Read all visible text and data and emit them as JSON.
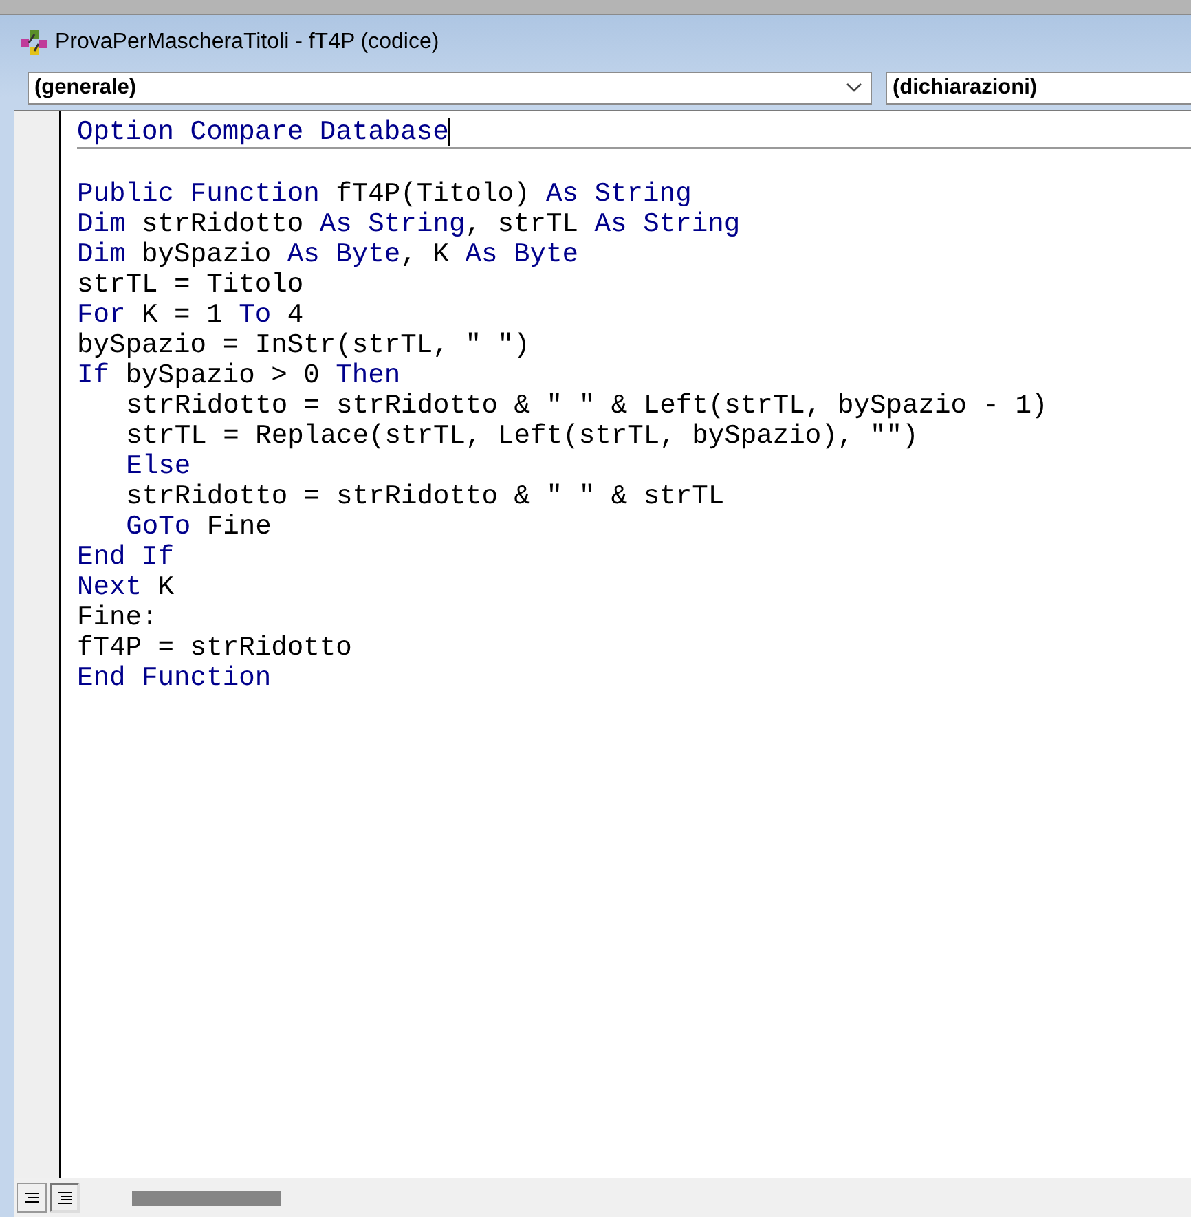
{
  "window": {
    "title": "ProvaPerMascheraTitoli - fT4P (codice)"
  },
  "object_dropdown": {
    "value": "(generale)"
  },
  "procedure_dropdown": {
    "value": "(dichiarazioni)"
  },
  "sections": [
    {
      "lines": [
        {
          "indented": false,
          "tokens": [
            {
              "kind": "keyword",
              "text": "Option Compare Database"
            }
          ]
        }
      ]
    },
    {
      "lines": [
        {
          "indented": false,
          "tokens": [
            {
              "kind": "keyword",
              "text": "Public Function"
            },
            {
              "kind": "plain",
              "text": " fT4P(Titolo) "
            },
            {
              "kind": "keyword",
              "text": "As String"
            }
          ]
        },
        {
          "indented": false,
          "tokens": [
            {
              "kind": "keyword",
              "text": "Dim"
            },
            {
              "kind": "plain",
              "text": " strRidotto "
            },
            {
              "kind": "keyword",
              "text": "As String"
            },
            {
              "kind": "plain",
              "text": ", strTL "
            },
            {
              "kind": "keyword",
              "text": "As String"
            }
          ]
        },
        {
          "indented": false,
          "tokens": [
            {
              "kind": "keyword",
              "text": "Dim"
            },
            {
              "kind": "plain",
              "text": " bySpazio "
            },
            {
              "kind": "keyword",
              "text": "As Byte"
            },
            {
              "kind": "plain",
              "text": ", K "
            },
            {
              "kind": "keyword",
              "text": "As Byte"
            }
          ]
        },
        {
          "indented": false,
          "tokens": [
            {
              "kind": "plain",
              "text": "strTL = Titolo"
            }
          ]
        },
        {
          "indented": false,
          "tokens": [
            {
              "kind": "keyword",
              "text": "For"
            },
            {
              "kind": "plain",
              "text": " K = 1 "
            },
            {
              "kind": "keyword",
              "text": "To"
            },
            {
              "kind": "plain",
              "text": " 4"
            }
          ]
        },
        {
          "indented": false,
          "tokens": [
            {
              "kind": "plain",
              "text": "bySpazio = InStr(strTL, \" \")"
            }
          ]
        },
        {
          "indented": false,
          "tokens": [
            {
              "kind": "keyword",
              "text": "If"
            },
            {
              "kind": "plain",
              "text": " bySpazio > 0 "
            },
            {
              "kind": "keyword",
              "text": "Then"
            }
          ]
        },
        {
          "indented": true,
          "tokens": [
            {
              "kind": "plain",
              "text": "strRidotto = strRidotto & \" \" & Left(strTL, bySpazio - 1)"
            }
          ]
        },
        {
          "indented": true,
          "tokens": [
            {
              "kind": "plain",
              "text": "strTL = Replace(strTL, Left(strTL, bySpazio), \"\")"
            }
          ]
        },
        {
          "indented": true,
          "tokens": [
            {
              "kind": "keyword",
              "text": "Else"
            }
          ]
        },
        {
          "indented": true,
          "tokens": [
            {
              "kind": "plain",
              "text": "strRidotto = strRidotto & \" \" & strTL"
            }
          ]
        },
        {
          "indented": true,
          "tokens": [
            {
              "kind": "keyword",
              "text": "GoTo"
            },
            {
              "kind": "plain",
              "text": " Fine"
            }
          ]
        },
        {
          "indented": false,
          "tokens": [
            {
              "kind": "keyword",
              "text": "End If"
            }
          ]
        },
        {
          "indented": false,
          "tokens": [
            {
              "kind": "keyword",
              "text": "Next"
            },
            {
              "kind": "plain",
              "text": " K"
            }
          ]
        },
        {
          "indented": false,
          "tokens": [
            {
              "kind": "plain",
              "text": "Fine:"
            }
          ]
        },
        {
          "indented": false,
          "tokens": [
            {
              "kind": "plain",
              "text": "fT4P = strRidotto"
            }
          ]
        },
        {
          "indented": false,
          "tokens": [
            {
              "kind": "keyword",
              "text": "End Function"
            }
          ]
        }
      ]
    }
  ]
}
